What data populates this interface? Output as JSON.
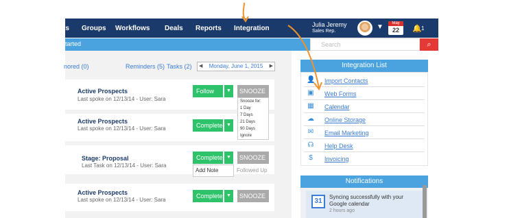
{
  "nav": {
    "items": [
      "ts",
      "Groups",
      "Workflows",
      "Deals",
      "Reports",
      "Integration"
    ],
    "user_name": "Julia Jeremy",
    "user_role": "Sales Rep.",
    "cal_month": "May",
    "cal_day": "22",
    "bell_count": "1"
  },
  "subbar": {
    "label": "tarted"
  },
  "search": {
    "placeholder": "Search"
  },
  "main": {
    "ignored_link": "nored (0)",
    "reminders_link": "Reminders (5)",
    "tasks_link": "Tasks (2)",
    "date": "Monday, June 1, 2015"
  },
  "cards": [
    {
      "title": "Active Prospects",
      "sub": "Last spoke on 12/13/14 - User: Sara",
      "action": "Follow Up",
      "snooze": "SNOOZE"
    },
    {
      "title": "Active Prospects",
      "sub": "Last spoke on 12/13/14 - User: Sara",
      "action": "Complete"
    },
    {
      "title": "Stage: Proposal",
      "sub": "Last Task on 12/13/14 - User: Sara",
      "action": "Complete",
      "snooze": "SNOOZE",
      "add_note": "Add Note",
      "followed_up": "Followed Up"
    },
    {
      "title": "Active Prospects",
      "sub": "Last spoke on 12/13/14 - User: Sara",
      "action": "Complete",
      "snooze": "SNOOZE"
    }
  ],
  "snooze_menu": [
    "Snooze for:",
    "1 Day",
    "7 Days",
    "21 Days",
    "90 Days",
    "Ignore"
  ],
  "integration": {
    "title": "Integration List",
    "items": [
      {
        "label": "Import Contacts",
        "icon": "person-icon"
      },
      {
        "label": "Web Forms",
        "icon": "form-icon"
      },
      {
        "label": "Calendar",
        "icon": "calendar-icon"
      },
      {
        "label": "Online Storage",
        "icon": "cloud-icon"
      },
      {
        "label": "Email Marketing",
        "icon": "email-icon"
      },
      {
        "label": "Help Desk",
        "icon": "helpdesk-icon"
      },
      {
        "label": "Invoicing",
        "icon": "dollar-icon"
      }
    ]
  },
  "notifications": {
    "title": "Notifications",
    "gcal_day": "31",
    "text": "Syncing successfully with your Google calendar",
    "time": "2 hours ago"
  },
  "colors": {
    "nav": "#1a3a6b",
    "accent": "#4aa3df",
    "green": "#2ec36a",
    "annotation": "#f0922b"
  }
}
